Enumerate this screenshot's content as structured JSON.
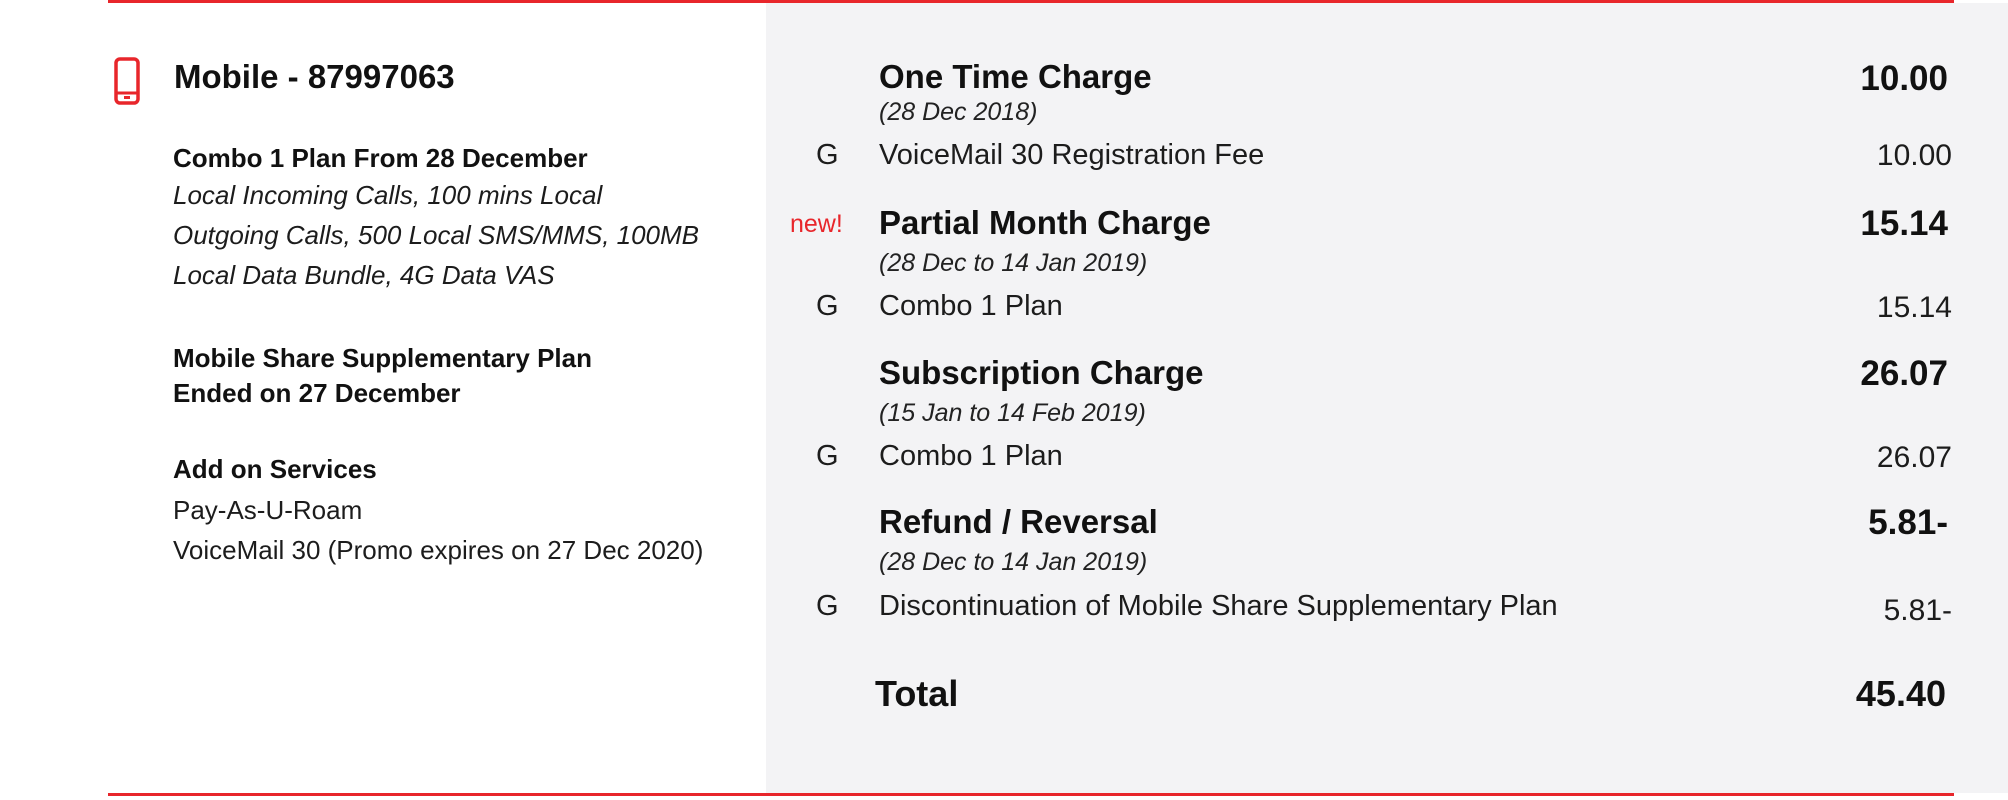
{
  "colors": {
    "accent": "#e8262b",
    "panel": "#f3f3f5"
  },
  "left": {
    "icon": "mobile-phone-icon",
    "title": "Mobile - 87997063",
    "plan": {
      "name": "Combo 1 Plan From 28 December",
      "lines": [
        "Local Incoming Calls, 100 mins Local",
        "Outgoing Calls, 500 Local SMS/MMS, 100MB",
        "Local Data Bundle, 4G Data VAS"
      ]
    },
    "supplementary": {
      "line1": "Mobile Share Supplementary Plan",
      "line2": "Ended on 27 December"
    },
    "addons": {
      "title": "Add on Services",
      "items": [
        "Pay-As-U-Roam",
        "VoiceMail 30 (Promo expires on 27 Dec 2020)"
      ]
    }
  },
  "charges": [
    {
      "title": "One Time Charge",
      "period": "(28 Dec 2018)",
      "amount": "10.00",
      "tag": "",
      "item": {
        "code": "G",
        "desc": "VoiceMail 30 Registration Fee",
        "amount": "10.00"
      }
    },
    {
      "title": "Partial Month Charge",
      "period": "(28 Dec to 14 Jan 2019)",
      "amount": "15.14",
      "tag": "new!",
      "item": {
        "code": "G",
        "desc": "Combo 1 Plan",
        "amount": "15.14"
      }
    },
    {
      "title": "Subscription Charge",
      "period": "(15 Jan to 14 Feb 2019)",
      "amount": "26.07",
      "tag": "",
      "item": {
        "code": "G",
        "desc": "Combo 1 Plan",
        "amount": "26.07"
      }
    },
    {
      "title": "Refund / Reversal",
      "period": "(28 Dec to 14 Jan 2019)",
      "amount": "5.81-",
      "tag": "",
      "item": {
        "code": "G",
        "desc": "Discontinuation of Mobile Share Supplementary Plan",
        "amount": "5.81-"
      }
    }
  ],
  "total": {
    "label": "Total",
    "amount": "45.40"
  }
}
